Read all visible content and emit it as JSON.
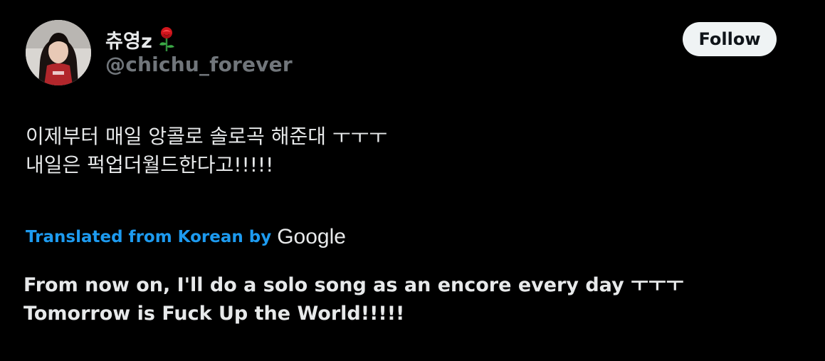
{
  "author": {
    "display_name": "츄영z",
    "handle": "@chichu_forever",
    "avatar_icon": "avatar-photo",
    "emoji_icon": "rose-icon"
  },
  "actions": {
    "follow_label": "Follow"
  },
  "tweet": {
    "text": "이제부터 매일 앙콜로 솔로곡 해준대 ㅜㅜㅜ\n내일은 퍽업더월드한다고!!!!!"
  },
  "translation": {
    "link_label": "Translated from Korean by",
    "provider": "Google",
    "text": "From now on, I'll do a solo song as an encore every day ㅜㅜㅜ\nTomorrow is Fuck Up the World!!!!!"
  },
  "colors": {
    "background": "#000000",
    "primary_text": "#e7e9ea",
    "secondary_text": "#71767b",
    "link": "#1d9bf0",
    "follow_bg": "#eff3f4",
    "follow_text": "#0f1419"
  }
}
